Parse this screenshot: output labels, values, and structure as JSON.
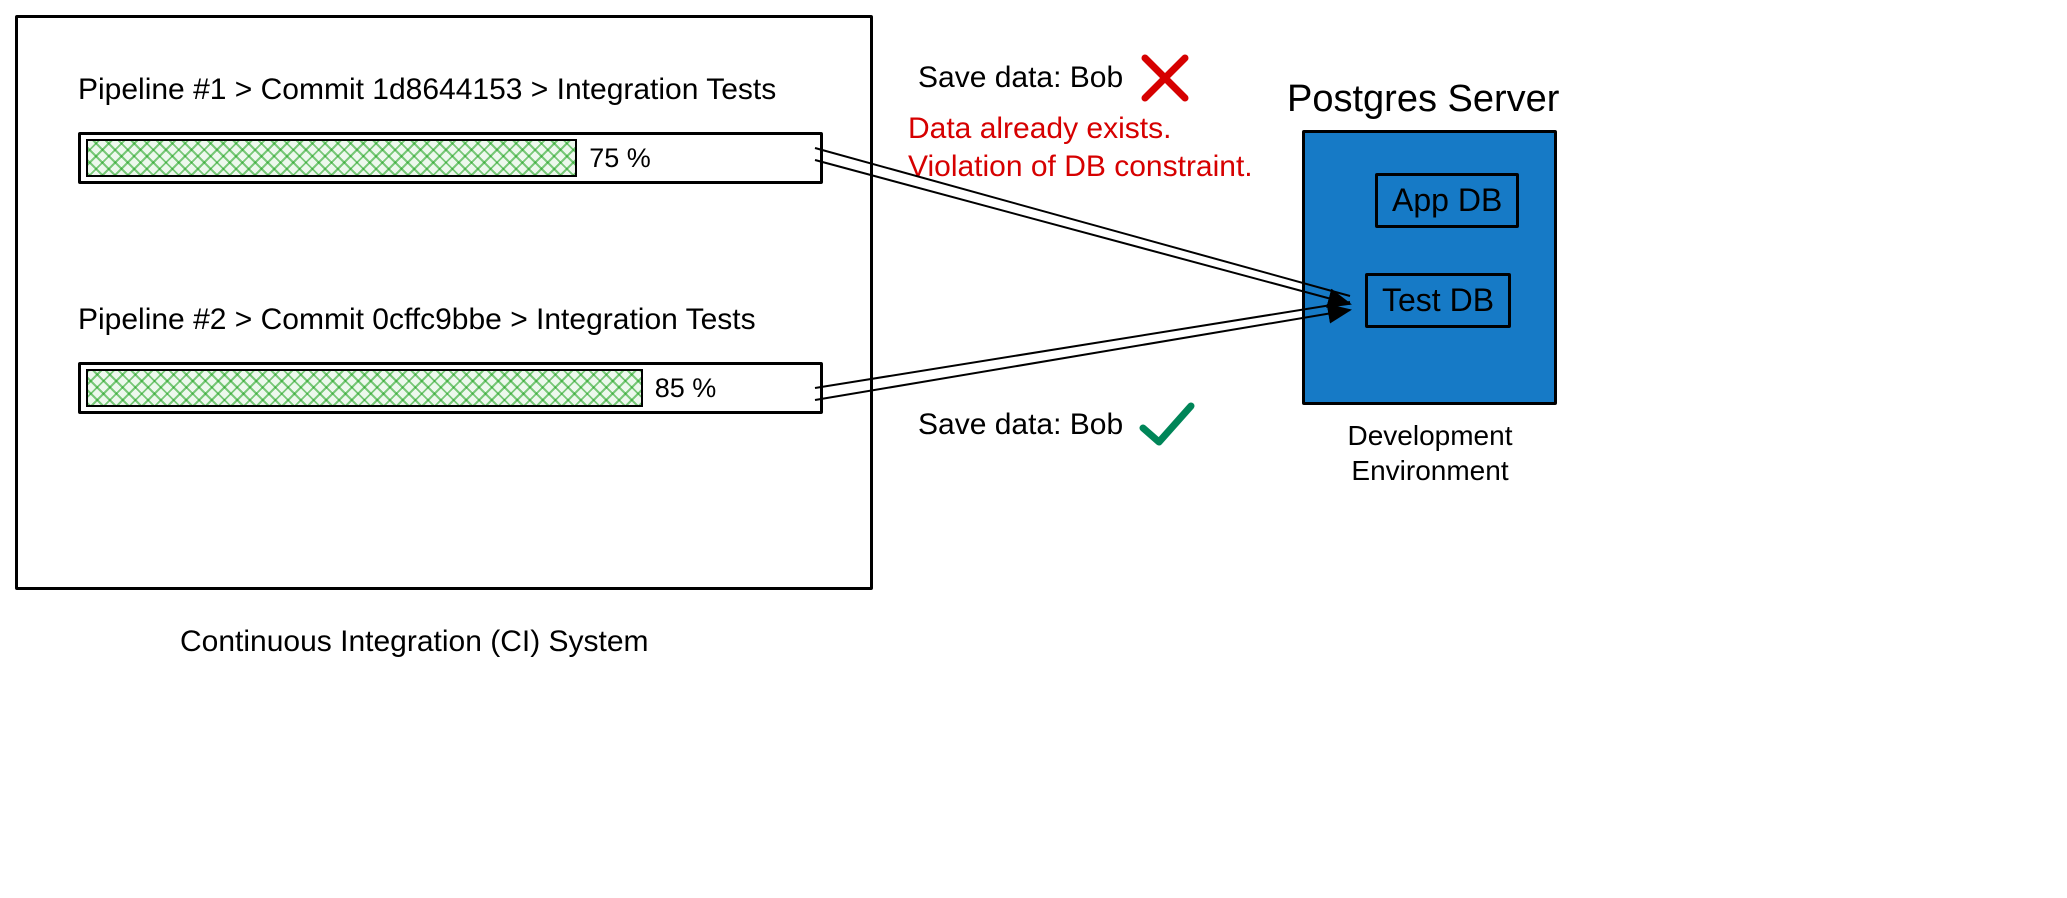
{
  "ci": {
    "caption": "Continuous Integration (CI) System",
    "pipelines": [
      {
        "label": "Pipeline #1 > Commit 1d8644153 > Integration Tests",
        "progress_pct": 75,
        "progress_text": "75 %"
      },
      {
        "label": "Pipeline #2 > Commit 0cffc9bbe > Integration Tests",
        "progress_pct": 85,
        "progress_text": "85 %"
      }
    ]
  },
  "messages": {
    "save1": "Save data: Bob",
    "save1_status": "fail",
    "error": "Data already exists.\nViolation of DB constraint.",
    "save2": "Save data: Bob",
    "save2_status": "ok"
  },
  "server": {
    "title": "Postgres Server",
    "db_app": "App DB",
    "db_test": "Test DB",
    "env": "Development\nEnvironment"
  },
  "colors": {
    "blue": "#167ac6",
    "red": "#d60000",
    "green_check": "#008558",
    "green_fill": "#3aa93a"
  }
}
